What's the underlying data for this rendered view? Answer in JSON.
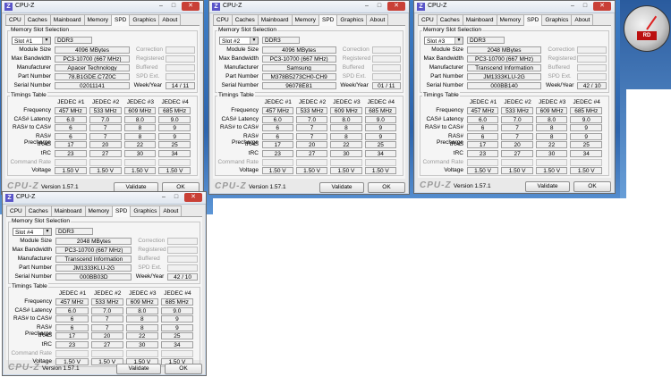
{
  "app_title": "CPU-Z",
  "icon_letter": "Z",
  "tabs": [
    "CPU",
    "Caches",
    "Mainboard",
    "Memory",
    "SPD",
    "Graphics",
    "About"
  ],
  "active_tab": "SPD",
  "labels": {
    "memory_slot_selection": "Memory Slot Selection",
    "module_size": "Module Size",
    "max_bandwidth": "Max Bandwidth",
    "manufacturer": "Manufacturer",
    "part_number": "Part Number",
    "serial_number": "Serial Number",
    "correction": "Correction",
    "registered": "Registered",
    "buffered": "Buffered",
    "spd_ext": "SPD Ext.",
    "week_year": "Week/Year",
    "timings_table": "Timings Table",
    "frequency": "Frequency",
    "cas_latency": "CAS# Latency",
    "ras_to_cas": "RAS# to CAS#",
    "ras_precharge": "RAS# Precharge",
    "tras": "tRAS",
    "trc": "tRC",
    "command_rate": "Command Rate",
    "voltage": "Voltage"
  },
  "footer": {
    "brand": "CPU-Z",
    "version": "Version 1.57.1",
    "validate": "Validate",
    "ok": "OK"
  },
  "timings": {
    "headers": [
      "JEDEC #1",
      "JEDEC #2",
      "JEDEC #3",
      "JEDEC #4"
    ],
    "frequency": [
      "457 MHz",
      "533 MHz",
      "609 MHz",
      "685 MHz"
    ],
    "cas": [
      "6.0",
      "7.0",
      "8.0",
      "9.0"
    ],
    "ras_to_cas": [
      "6",
      "7",
      "8",
      "9"
    ],
    "ras_precharge": [
      "6",
      "7",
      "8",
      "9"
    ],
    "tras": [
      "17",
      "20",
      "22",
      "25"
    ],
    "trc": [
      "23",
      "27",
      "30",
      "34"
    ],
    "voltage": [
      "1.50 V",
      "1.50 V",
      "1.50 V",
      "1.50 V"
    ]
  },
  "windows": [
    {
      "slot": "Slot #1",
      "type": "DDR3",
      "module_size": "4096 MBytes",
      "max_bandwidth": "PC3-10700 (667 MHz)",
      "manufacturer": "Apacer Technology",
      "part_number": "78.B1GDE.C7Z0C",
      "serial_number": "02011141",
      "week_year": "14 / 11"
    },
    {
      "slot": "Slot #2",
      "type": "DDR3",
      "module_size": "4096 MBytes",
      "max_bandwidth": "PC3-10700 (667 MHz)",
      "manufacturer": "Samsung",
      "part_number": "M378B5273CH0-CH9",
      "serial_number": "96078E81",
      "week_year": "01 / 11"
    },
    {
      "slot": "Slot #3",
      "type": "DDR3",
      "module_size": "2048 MBytes",
      "max_bandwidth": "PC3-10700 (667 MHz)",
      "manufacturer": "Transcend Information",
      "part_number": "JM1333KLU-2G",
      "serial_number": "000BB140",
      "week_year": "42 / 10"
    },
    {
      "slot": "Slot #4",
      "type": "DDR3",
      "module_size": "2048 MBytes",
      "max_bandwidth": "PC3-10700 (667 MHz)",
      "manufacturer": "Transcend Information",
      "part_number": "JM1333KLU-2G",
      "serial_number": "000BB03D",
      "week_year": "42 / 10"
    }
  ],
  "gadget_text": "RD"
}
